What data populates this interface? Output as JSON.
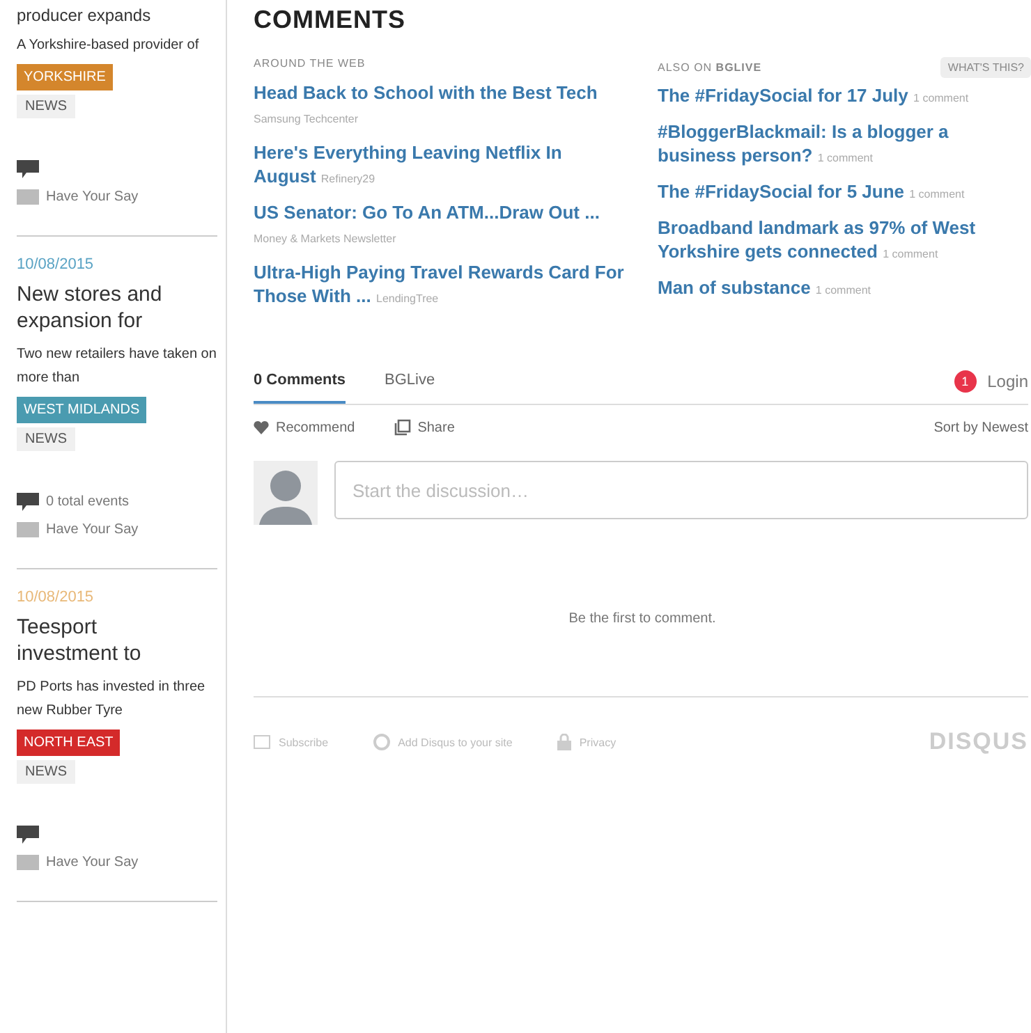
{
  "sidebar": {
    "articles": [
      {
        "headline": "producer expands",
        "summary": "A Yorkshire-based provider of",
        "region": {
          "label": "YORKSHIRE",
          "color": "#d4862c"
        },
        "category": "NEWS",
        "comment_link": "Have Your Say"
      },
      {
        "date": "10/08/2015",
        "color": "#5aa3c4",
        "headline": "New stores and expansion for",
        "summary": "Two new retailers have taken on more than",
        "region": {
          "label": "WEST MIDLANDS",
          "color": "#4a9bb0"
        },
        "category": "NEWS",
        "comment_count": "0 total events",
        "comment_link": "Have Your Say"
      },
      {
        "date": "10/08/2015",
        "color": "#e8b878",
        "headline": "Teesport investment to",
        "summary": "PD Ports has invested in three new Rubber Tyre",
        "region": {
          "label": "NORTH EAST",
          "color": "#d42a2a"
        },
        "category": "NEWS",
        "comment_link": "Have Your Say"
      }
    ]
  },
  "comments": {
    "heading": "COMMENTS",
    "around_the_web": {
      "label": "AROUND THE WEB",
      "links": [
        {
          "title": "Head Back to School with the Best Tech",
          "source": "Samsung Techcenter"
        },
        {
          "title": "Here's Everything Leaving Netflix In August",
          "source": "Refinery29"
        },
        {
          "title": "US Senator: Go To An ATM...Draw Out ...",
          "source": "Money & Markets Newsletter"
        },
        {
          "title": "Ultra-High Paying Travel Rewards Card For Those With ...",
          "source": "LendingTree"
        }
      ]
    },
    "also_on": {
      "label": "ALSO ON **BGLIVE**",
      "badge": "WHAT'S THIS?",
      "links": [
        {
          "title": "The #FridaySocial for 17 July",
          "meta": "1 comment"
        },
        {
          "title": "#BloggerBlackmail: Is a blogger a business person?",
          "meta": "1 comment"
        },
        {
          "title": "The #FridaySocial for 5 June",
          "meta": "1 comment"
        },
        {
          "title": "Broadband landmark as 97% of West Yorkshire gets connected",
          "meta": "1 comment"
        },
        {
          "title": "Man of substance",
          "meta": "1 comment"
        }
      ]
    },
    "tabs": [
      {
        "label": "0 Comments",
        "selected": true
      },
      {
        "label": "BGLive",
        "selected": false
      }
    ],
    "login": {
      "badge": "1",
      "label": "Login"
    },
    "recommend": "Recommend",
    "share": "Share",
    "sort": "Sort by Newest",
    "composer": {
      "placeholder": "Start the discussion…"
    },
    "empty": "Be the first to comment.",
    "footer": {
      "subscribe": "Subscribe",
      "add": "Add Disqus to your site",
      "privacy": "Privacy",
      "logo": "DISQUS"
    }
  }
}
